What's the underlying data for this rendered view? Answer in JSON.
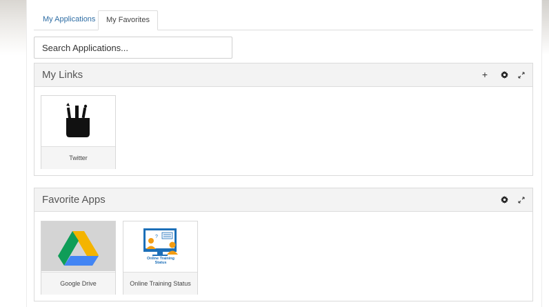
{
  "tabs": [
    {
      "label": "My Applications",
      "active": false
    },
    {
      "label": "My Favorites",
      "active": true
    }
  ],
  "search": {
    "placeholder": "Search Applications..."
  },
  "my_links": {
    "title": "My Links",
    "controls": {
      "add": "+",
      "settings_icon": "gear-icon",
      "expand_icon": "expand-icon"
    },
    "tiles": [
      {
        "label": "Twitter",
        "icon": "pencil-cup-icon"
      }
    ]
  },
  "favorite_apps": {
    "title": "Favorite Apps",
    "controls": {
      "settings_icon": "gear-icon",
      "expand_icon": "expand-icon"
    },
    "tiles": [
      {
        "label": "Google Drive",
        "icon": "google-drive-icon"
      },
      {
        "label": "Online Training Status",
        "icon": "online-training-icon",
        "icon_caption": "Online Training Status"
      }
    ]
  },
  "colors": {
    "tab_link": "#2e6da4",
    "panel_header": "#f3f3f3",
    "drive_yellow": "#f4b400",
    "drive_green": "#0f9d58",
    "drive_blue": "#4285f4",
    "training_blue": "#1c6fb8",
    "training_orange": "#f39c12"
  }
}
